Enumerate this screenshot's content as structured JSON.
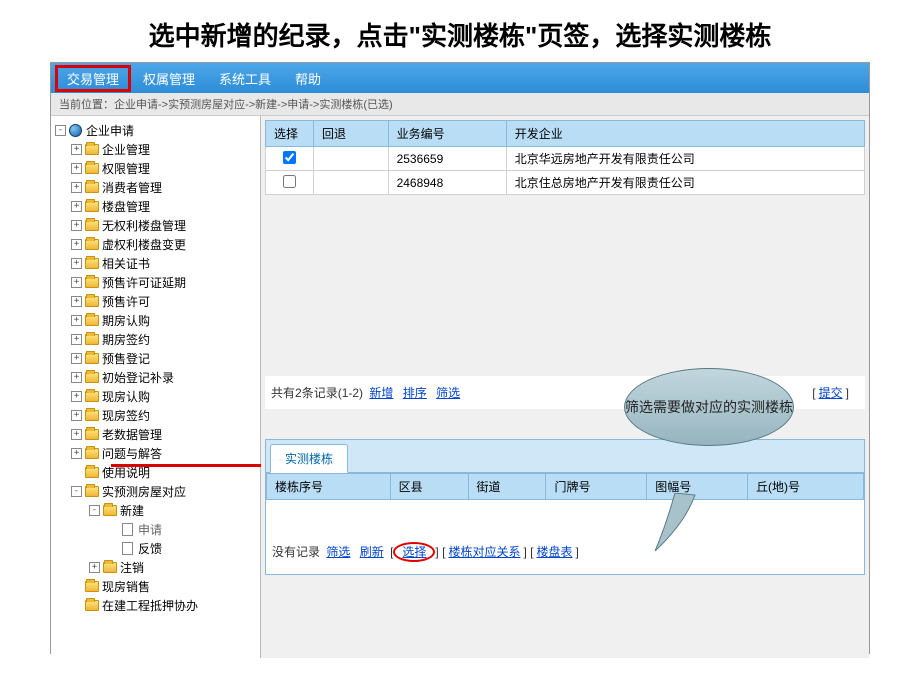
{
  "slide_title": "选中新增的纪录，点击\"实测楼栋\"页签，选择实测楼栋",
  "menu": {
    "items": [
      "交易管理",
      "权属管理",
      "系统工具",
      "帮助"
    ]
  },
  "breadcrumb": "当前位置：企业申请->实预测房屋对应->新建->申请->实测楼栋(已选)",
  "tree": {
    "root": "企业申请",
    "items": [
      "企业管理",
      "权限管理",
      "消费者管理",
      "楼盘管理",
      "无权利楼盘管理",
      "虚权利楼盘变更",
      "相关证书",
      "预售许可证延期",
      "预售许可",
      "期房认购",
      "期房签约",
      "预售登记",
      "初始登记补录",
      "现房认购",
      "现房签约",
      "老数据管理",
      "问题与解答",
      "使用说明"
    ],
    "expanded_node": "实预测房屋对应",
    "sub_expanded": "新建",
    "leaf_items": [
      "申请",
      "反馈"
    ],
    "more_sub": "注销",
    "extra": [
      "现房销售",
      "在建工程抵押协办"
    ]
  },
  "table": {
    "headers": [
      "选择",
      "回退",
      "业务编号",
      "开发企业"
    ],
    "rows": [
      {
        "checked": true,
        "id": "2536659",
        "company": "北京华远房地产开发有限责任公司"
      },
      {
        "checked": false,
        "id": "2468948",
        "company": "北京住总房地产开发有限责任公司"
      }
    ],
    "footer_prefix": "共有",
    "footer_count": "2",
    "footer_suffix": "条记录(1-2)",
    "links": [
      "新增",
      "排序",
      "筛选"
    ],
    "submit": "提交"
  },
  "sub_panel": {
    "tab": "实测楼栋",
    "headers": [
      "楼栋序号",
      "区县",
      "街道",
      "门牌号",
      "图幅号",
      "丘(地)号"
    ],
    "footer_prefix": "没有记录",
    "links": [
      "筛选",
      "刷新"
    ],
    "select_link": "选择",
    "extra_links": [
      "楼栋对应关系",
      "楼盘表"
    ]
  },
  "callout": "筛选需要做对应的实测楼栋"
}
